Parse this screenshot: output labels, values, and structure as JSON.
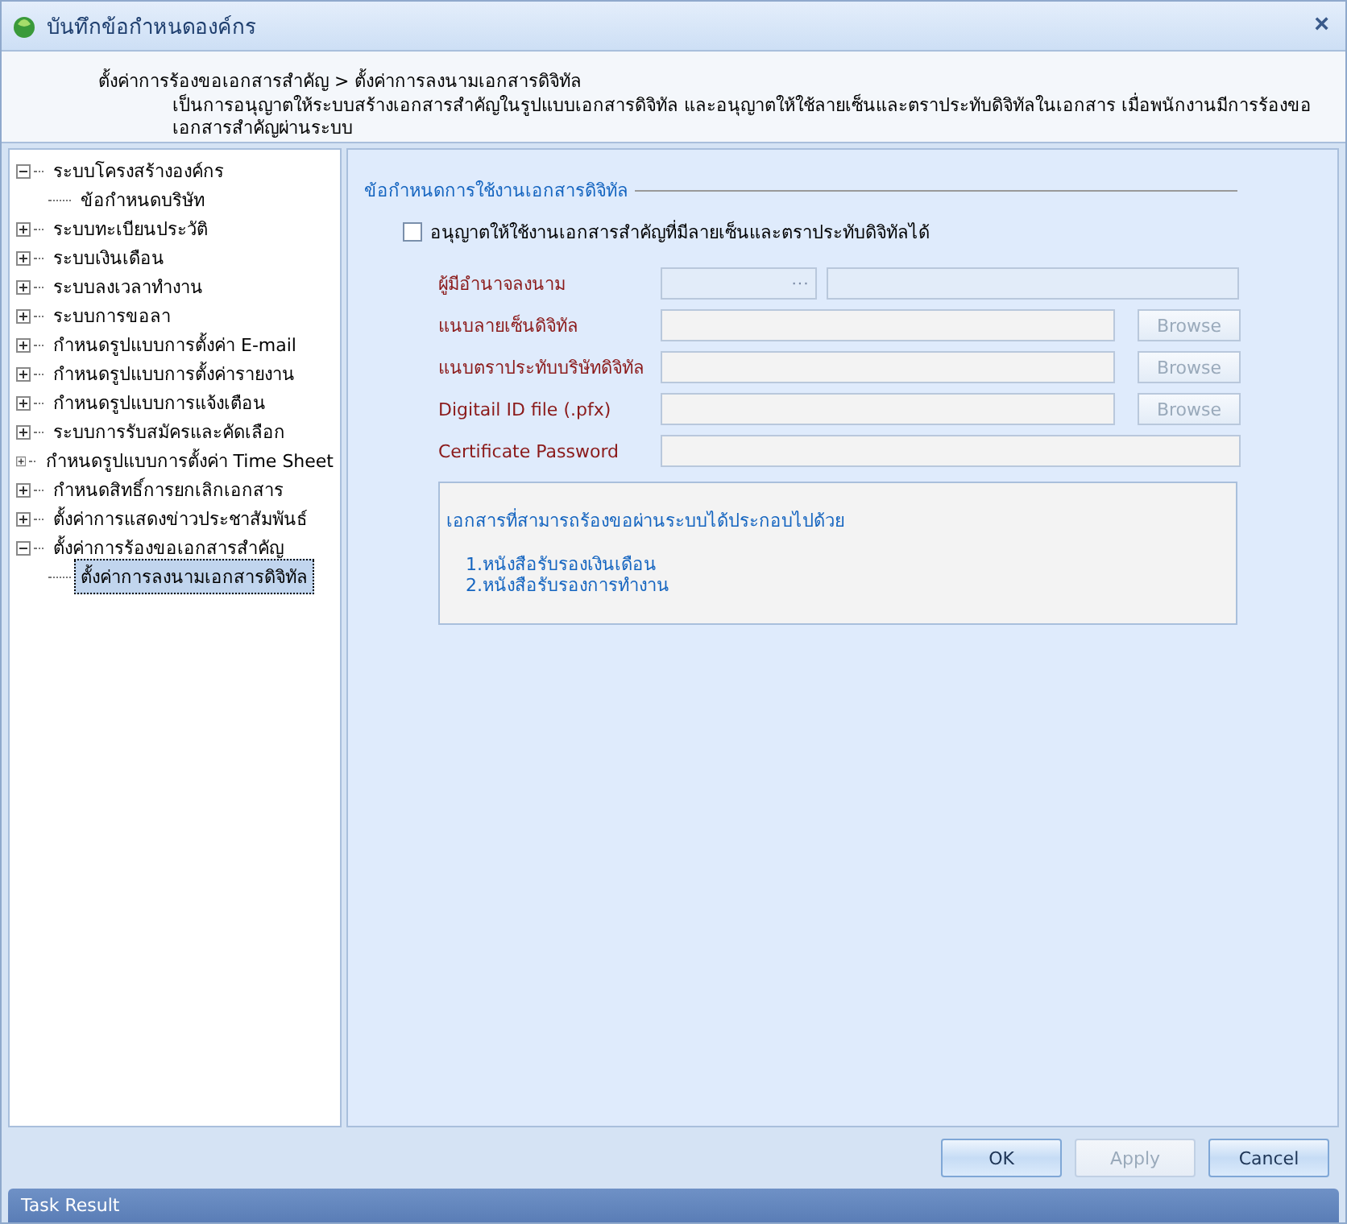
{
  "window": {
    "title": "บันทึกข้อกำหนดองค์กร",
    "close": "×"
  },
  "header": {
    "breadcrumb": "ตั้งค่าการร้องขอเอกสารสำคัญ > ตั้งค่าการลงนามเอกสารดิจิทัล",
    "description": "เป็นการอนุญาตให้ระบบสร้างเอกสารสำคัญในรูปแบบเอกสารดิจิทัล และอนุญาตให้ใช้ลายเซ็นและตราประทับดิจิทัลในเอกสาร เมื่อพนักงานมีการร้องขอเอกสารสำคัญผ่านระบบ"
  },
  "tree": [
    {
      "label": "ระบบโครงสร้างองค์กร",
      "expanded": true,
      "selected": false,
      "children": [
        {
          "label": "ข้อกำหนดบริษัท",
          "selected": false
        }
      ]
    },
    {
      "label": "ระบบทะเบียนประวัติ",
      "expanded": false,
      "selected": false
    },
    {
      "label": "ระบบเงินเดือน",
      "expanded": false,
      "selected": false
    },
    {
      "label": "ระบบลงเวลาทำงาน",
      "expanded": false,
      "selected": false
    },
    {
      "label": "ระบบการขอลา",
      "expanded": false,
      "selected": false
    },
    {
      "label": "กำหนดรูปแบบการตั้งค่า E-mail",
      "expanded": false,
      "selected": false
    },
    {
      "label": "กำหนดรูปแบบการตั้งค่ารายงาน",
      "expanded": false,
      "selected": false
    },
    {
      "label": "กำหนดรูปแบบการแจ้งเตือน",
      "expanded": false,
      "selected": false
    },
    {
      "label": "ระบบการรับสมัครและคัดเลือก",
      "expanded": false,
      "selected": false
    },
    {
      "label": "กำหนดรูปแบบการตั้งค่า Time Sheet",
      "expanded": false,
      "selected": false
    },
    {
      "label": "กำหนดสิทธิ์การยกเลิกเอกสาร",
      "expanded": false,
      "selected": false
    },
    {
      "label": "ตั้งค่าการแสดงข่าวประชาสัมพันธ์",
      "expanded": false,
      "selected": false
    },
    {
      "label": "ตั้งค่าการร้องขอเอกสารสำคัญ",
      "expanded": true,
      "selected": false,
      "children": [
        {
          "label": "ตั้งค่าการลงนามเอกสารดิจิทัล",
          "selected": true
        }
      ]
    }
  ],
  "section": {
    "title": "ข้อกำหนดการใช้งานเอกสารดิจิทัล",
    "checkbox": {
      "label": "อนุญาตให้ใช้งานเอกสารสำคัญที่มีลายเซ็นและตราประทับดิจิทัลได้",
      "checked": false
    },
    "fields": [
      {
        "kind": "lookup",
        "label": "ผู้มีอำนาจลงนาม",
        "button": "···"
      },
      {
        "kind": "browse",
        "label": "แนบลายเซ็นดิจิทัล",
        "button": "Browse"
      },
      {
        "kind": "browse",
        "label": "แนบตราประทับบริษัทดิจิทัล",
        "button": "Browse"
      },
      {
        "kind": "browse",
        "label": "Digitail ID file (.pfx)",
        "button": "Browse"
      },
      {
        "kind": "text",
        "label": "Certificate Password"
      }
    ],
    "note": {
      "title": "เอกสารที่สามารถร้องขอผ่านระบบได้ประกอบไปด้วย",
      "items": [
        "1.หนังสือรับรองเงินเดือน",
        "2.หนังสือรับรองการทำงาน"
      ]
    }
  },
  "buttons": [
    {
      "label": "OK",
      "disabled": false
    },
    {
      "label": "Apply",
      "disabled": true
    },
    {
      "label": "Cancel",
      "disabled": false
    }
  ],
  "status_bar": {
    "title": "Task Result"
  }
}
